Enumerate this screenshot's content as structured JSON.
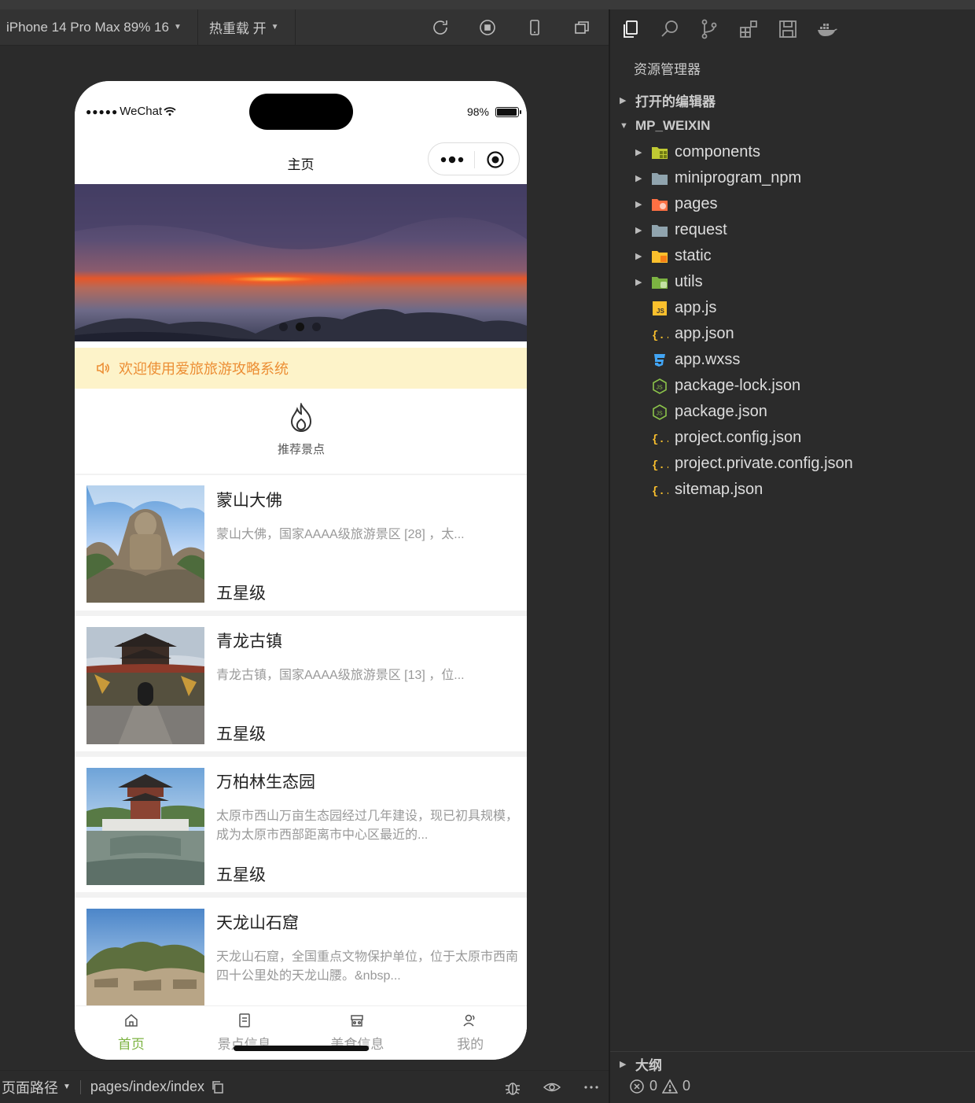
{
  "toolbar": {
    "device": "iPhone 14 Pro Max 89% 16",
    "hot_reload": "热重载 开"
  },
  "phone": {
    "carrier": "WeChat",
    "battery": "98%",
    "battery_level": 0.98,
    "nav_title": "主页",
    "notice": "欢迎使用爱旅旅游攻略系统",
    "banner_dots_count": 3,
    "banner_active_dot": 2,
    "category_label": "推荐景点",
    "spots": [
      {
        "title": "蒙山大佛",
        "desc": "蒙山大佛，国家AAAA级旅游景区 [28] ，太...",
        "level": "五星级"
      },
      {
        "title": "青龙古镇",
        "desc": "青龙古镇，国家AAAA级旅游景区 [13] ，位...",
        "level": "五星级"
      },
      {
        "title": "万柏林生态园",
        "desc": "太原市西山万亩生态园经过几年建设，现已初具规模，成为太原市西部距离市中心区最近的...",
        "level": "五星级"
      },
      {
        "title": "天龙山石窟",
        "desc": "天龙山石窟，全国重点文物保护单位，位于太原市西南四十公里处的天龙山腰。&nbsp...",
        "level": ""
      }
    ],
    "tabs": [
      {
        "label": "首页",
        "icon": "home-icon",
        "active": true
      },
      {
        "label": "景点信息",
        "icon": "document-icon",
        "active": false
      },
      {
        "label": "美食信息",
        "icon": "shop-icon",
        "active": false
      },
      {
        "label": "我的",
        "icon": "user-icon",
        "active": false
      }
    ]
  },
  "bottom_bar": {
    "path_label": "页面路径",
    "path": "pages/index/index"
  },
  "explorer": {
    "title": "资源管理器",
    "open_editors": "打开的编辑器",
    "project": "MP_WEIXIN",
    "items": [
      {
        "name": "components",
        "icon": "folder-components-icon",
        "folder": true
      },
      {
        "name": "miniprogram_npm",
        "icon": "folder-icon",
        "folder": true
      },
      {
        "name": "pages",
        "icon": "folder-pages-icon",
        "folder": true
      },
      {
        "name": "request",
        "icon": "folder-icon",
        "folder": true
      },
      {
        "name": "static",
        "icon": "folder-static-icon",
        "folder": true
      },
      {
        "name": "utils",
        "icon": "folder-utils-icon",
        "folder": true
      },
      {
        "name": "app.js",
        "icon": "js-file-icon",
        "folder": false
      },
      {
        "name": "app.json",
        "icon": "json-file-icon",
        "folder": false
      },
      {
        "name": "app.wxss",
        "icon": "css-file-icon",
        "folder": false
      },
      {
        "name": "package-lock.json",
        "icon": "node-file-icon",
        "folder": false
      },
      {
        "name": "package.json",
        "icon": "node-file-icon",
        "folder": false
      },
      {
        "name": "project.config.json",
        "icon": "json-file-icon",
        "folder": false
      },
      {
        "name": "project.private.config.json",
        "icon": "json-file-icon",
        "folder": false
      },
      {
        "name": "sitemap.json",
        "icon": "json-file-icon",
        "folder": false
      }
    ],
    "outline": "大纲",
    "errors": "0",
    "warnings": "0"
  },
  "colors": {
    "accent_green": "#7cb342",
    "notice_text": "#ec8e34",
    "notice_bg": "#fdf3c9"
  }
}
